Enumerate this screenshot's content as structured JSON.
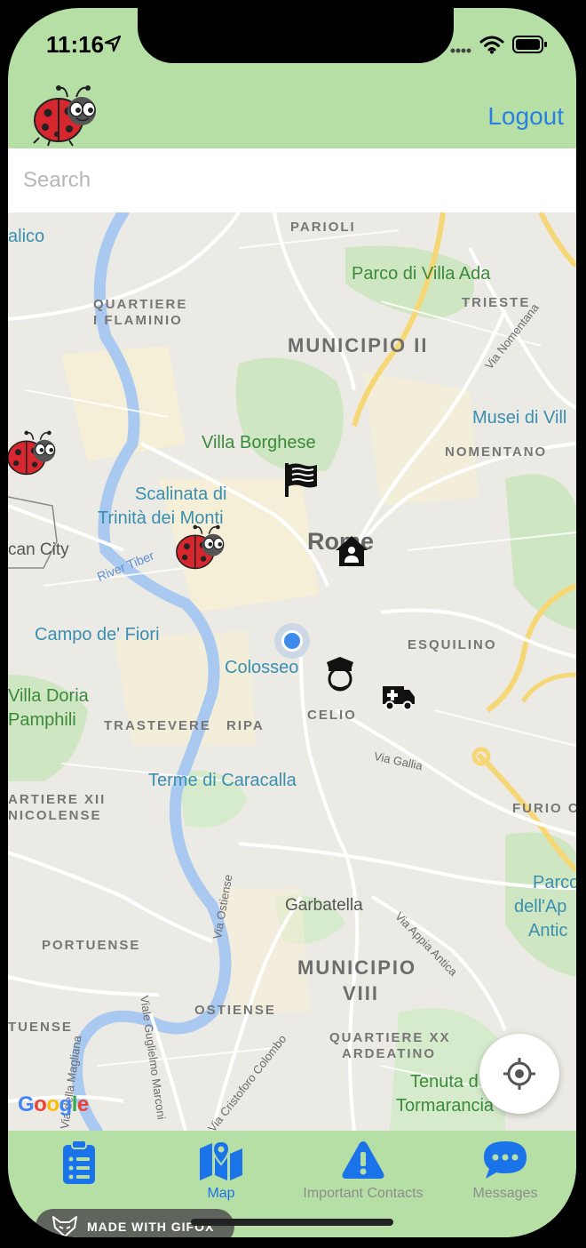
{
  "status_bar": {
    "time": "11:16"
  },
  "header": {
    "logout_label": "Logout"
  },
  "search": {
    "placeholder": "Search",
    "value": ""
  },
  "map": {
    "labels": {
      "parioli": "PARIOLI",
      "alico": "alico",
      "villa_ada": "Parco di Villa Ada",
      "quartiere": "QUARTIERE",
      "flaminio": "I FLAMINIO",
      "trieste": "TRIESTE",
      "municipio_ii": "MUNICIPIO II",
      "via_nomentana": "Via Nomentana",
      "musei": "Musei di Vill",
      "villa_borghese": "Villa Borghese",
      "nomentano": "NOMENTANO",
      "scalinata1": "Scalinata di",
      "scalinata2": "Trinità dei Monti",
      "rome": "Rome",
      "vatican": "can City",
      "river_tiber": "River Tiber",
      "campo": "Campo de' Fiori",
      "esquilino": "ESQUILINO",
      "colosseo": "Colosseo",
      "villa_doria1": "Villa Doria",
      "villa_doria2": "Pamphili",
      "trastevere": "TRASTEVERE",
      "ripa": "RIPA",
      "celio": "CELIO",
      "via_gallia": "Via Gallia",
      "caracalla": "Terme di Caracalla",
      "artiere_xii": "ARTIERE XII",
      "nicolense": "NICOLENSE",
      "furio": "FURIO CA",
      "parco_app1": "Parco",
      "parco_app2": "dell'Ap",
      "parco_app3": "Antic",
      "via_ostiense": "Via Ostiense",
      "garbatella": "Garbatella",
      "via_appia": "Via Appia Antica",
      "portuense": "PORTUENSE",
      "municipio_viii_1": "MUNICIPIO",
      "municipio_viii_2": "VIII",
      "tuense": "TUENSE",
      "ostiense": "OSTIENSE",
      "viale_marconi": "Viale Guglielmo Marconi",
      "via_magliana": "Via della Magliana",
      "quartiere_xx": "QUARTIERE XX",
      "ardeatino": "ARDEATINO",
      "via_colombo": "Via Cristoforo Colombo",
      "tenuta1": "Tenuta d",
      "tenuta2": "Tormarancia"
    },
    "attribution": "Google"
  },
  "tabs": [
    {
      "label": "",
      "icon": "clipboard-list-icon"
    },
    {
      "label": "Map",
      "icon": "map-icon"
    },
    {
      "label": "Important Contacts",
      "icon": "warning-icon"
    },
    {
      "label": "Messages",
      "icon": "chat-icon"
    }
  ],
  "watermark": {
    "label": "MADE WITH GIFOX"
  },
  "colors": {
    "header_bg": "#b6dfa6",
    "accent": "#2a7fe0",
    "tab_active": "#1a73e8"
  }
}
